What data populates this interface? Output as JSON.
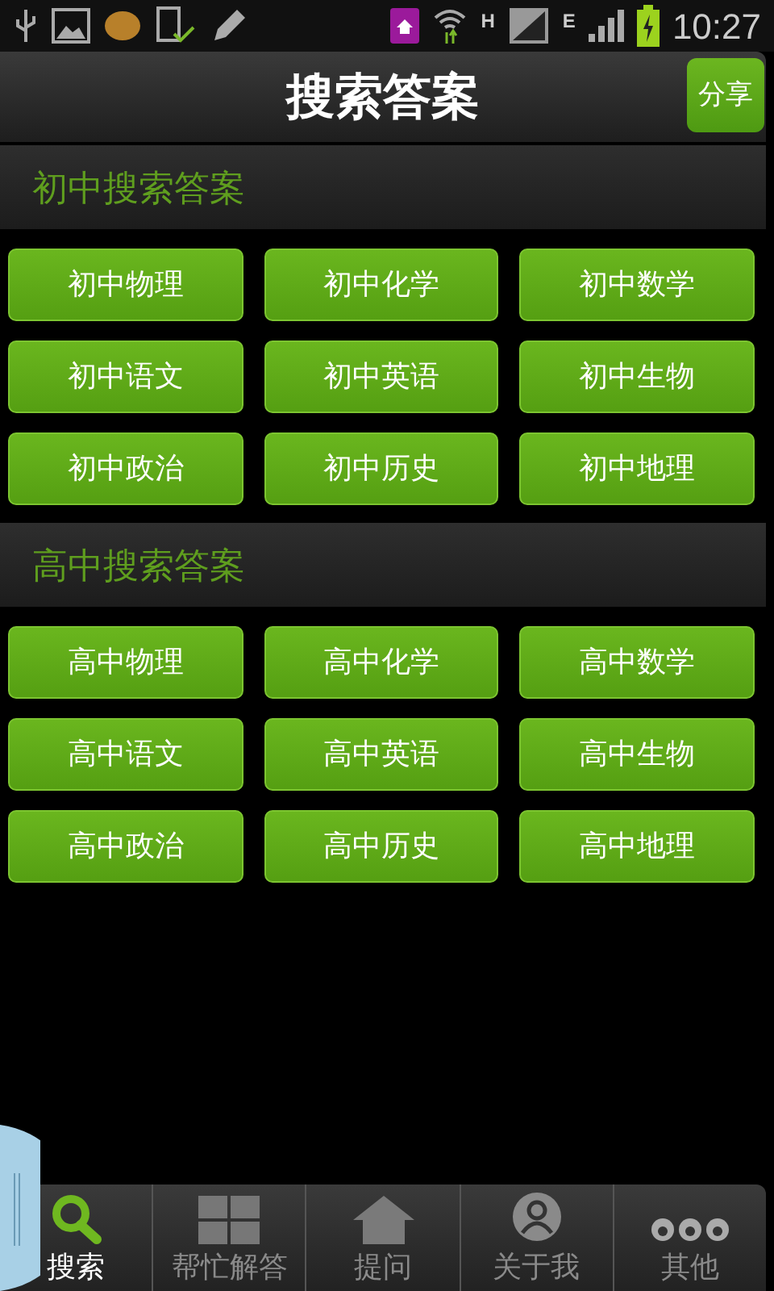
{
  "status_bar": {
    "network_h": "H",
    "network_e": "E",
    "time": "10:27"
  },
  "header": {
    "title": "搜索答案",
    "share_button": "分享"
  },
  "sections": [
    {
      "title": "初中搜索答案",
      "buttons": [
        "初中物理",
        "初中化学",
        "初中数学",
        "初中语文",
        "初中英语",
        "初中生物",
        "初中政治",
        "初中历史",
        "初中地理"
      ]
    },
    {
      "title": "高中搜索答案",
      "buttons": [
        "高中物理",
        "高中化学",
        "高中数学",
        "高中语文",
        "高中英语",
        "高中生物",
        "高中政治",
        "高中历史",
        "高中地理"
      ]
    }
  ],
  "bottom_nav": [
    {
      "kind": "search",
      "label": "搜索",
      "selected": true
    },
    {
      "kind": "grid",
      "label": "帮忙解答",
      "selected": false
    },
    {
      "kind": "home",
      "label": "提问",
      "selected": false
    },
    {
      "kind": "person",
      "label": "关于我",
      "selected": false
    },
    {
      "kind": "more",
      "label": "其他",
      "selected": false
    }
  ]
}
